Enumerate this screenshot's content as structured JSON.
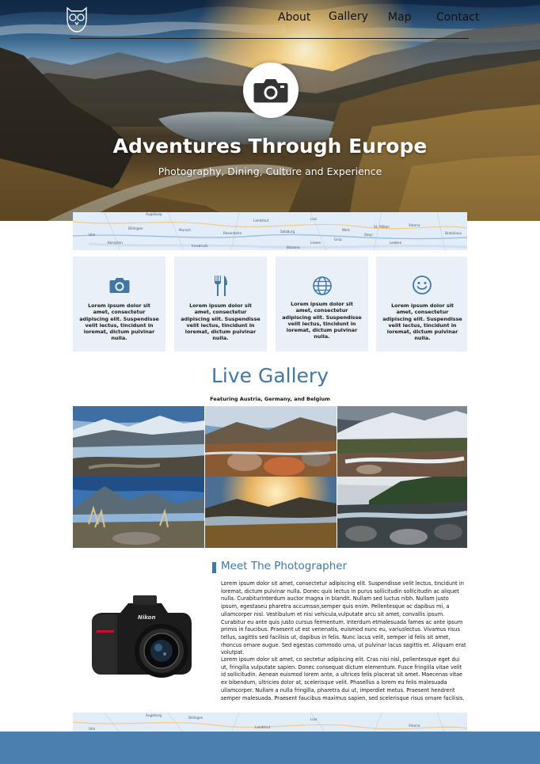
{
  "nav": {
    "items": [
      "About",
      "Gallery",
      "Map",
      "Contact"
    ]
  },
  "hero": {
    "title": "Adventures Through Europe",
    "subtitle": "Photography, Dining, Culture and Experience",
    "icon": "camera-icon"
  },
  "features": [
    {
      "icon": "camera-icon",
      "text": "Lorem ipsum dolor sit amet, consectetur adipiscing elit. Suspendisse velit lectus, tincidunt in loremat, dictum pulvinar nulla."
    },
    {
      "icon": "fork-knife-icon",
      "text": "Lorem ipsum dolor sit amet, consectetur adipiscing elit. Suspendisse velit lectus, tincidunt in loremat, dictum pulvinar nulla."
    },
    {
      "icon": "globe-icon",
      "text": "Lorem ipsum dolor sit amet, consectetur adipiscing elit. Suspendisse velit lectus, tincidunt in loremat, dictum pulvinar nulla."
    },
    {
      "icon": "smiley-icon",
      "text": "Lorem ipsum dolor sit amet, consectetur adipiscing elit. Suspendisse velit lectus, tincidunt in loremat, dictum pulvinar nulla."
    }
  ],
  "gallery": {
    "title": "Live Gallery",
    "subtitle": "Featuring Austria, Germany, and Belgium"
  },
  "photographer": {
    "title": "Meet The Photographer",
    "paragraph1": "Lorem ipsum dolor sit amet, consectetur adipiscing elit. Suspendisse velit lectus, tincidunt in loremat, dictum pulvinar nulla. Donec quis lectus in purus sollicitudin sollicitudin ac aliquet nulla. Curabiturinterdum auctor magna in blandit. Nullam sed luctus nibh. Nullam justo ipsum, egestaseu pharetra accumsan,semper quis enim. Pellentesque ac dapibus mi, a ullamcorper nisl. Vestibulum et nisi vehicula,vulputate arcu sit amet, convallis ipsum. Curabitur eu ante quis justo cursus fermentum. Interdum etmalesuada fames ac ante ipsum primis in faucibus. Praesent ut est venenatis, euismod nunc eu, variuslectus. Vivamus risus tellus, sagittis sed facilisis ut, dapibus in felis. Nunc lacus velit, semper id felis sit amet, rhoncus ornare augue. Sed egestas commodo urna, ut pulvinar lacus sagittis et. Aliquam erat volutpat.",
    "paragraph2": "Lorem ipsum dolor sit amet, co sectetur adipiscing elit. Cras nisi nisl, pellentesque eget dui ut, fringilla vulputate sapien. Donec consequat dictum elementum. Fusce fringilla vitae velit id sollicitudin. Aenean euismod lorem ante, a ultrices felis placerat sit amet. Maecenas vitae ex bibendum, ultricies dolor at, scelerisque velit. Phasellus a lorem eu felis malesuada ullamcorper. Nullam a nulla fringilla, pharetra dui ut, imperdiet metus. Praesent hendrerit semper malesuada. Praesent faucibus maximus sapien, sed scelerisque risus ornare facilisis.",
    "camera_brand": "Nikon"
  },
  "map_labels": [
    "Augsburg",
    "Ulm",
    "Dillingen",
    "Munich",
    "Rosenheim",
    "Salzburg",
    "Linz",
    "Vienna",
    "Bratislava",
    "Graz",
    "Innsbruck",
    "Bolzano",
    "Kempten",
    "Landshut",
    "St. Pölten",
    "Wels",
    "Steyr",
    "Liezen",
    "Leoben"
  ],
  "colors": {
    "accent": "#3f77a7",
    "card_bg": "#e9f0f8",
    "footer": "#4a7fb0"
  }
}
